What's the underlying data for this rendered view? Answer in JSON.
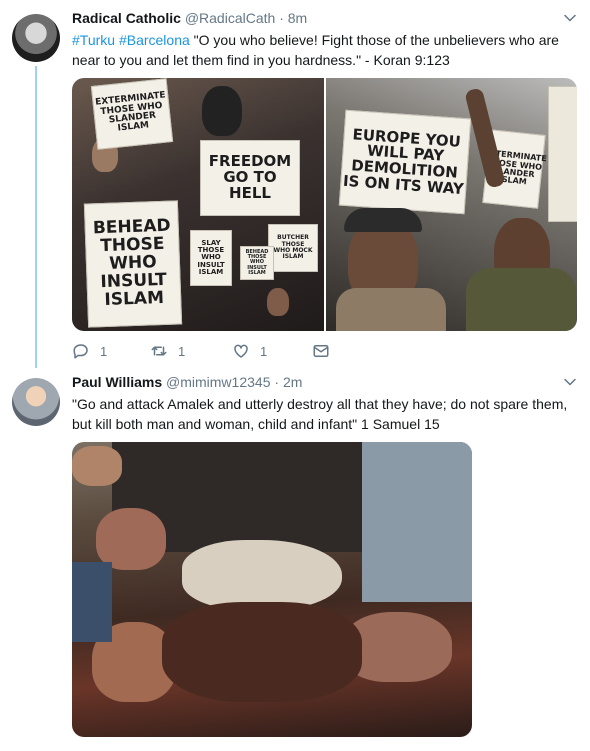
{
  "tweets": [
    {
      "author_name": "Radical Catholic",
      "handle": "@RadicalCath",
      "separator": "·",
      "time": "8m",
      "hashtags": [
        "#Turku",
        "#Barcelona"
      ],
      "text": "\"O you who believe! Fight those of the unbelievers who are near to you and let them find in you hardness.\" - Koran 9:123",
      "media": {
        "left_photo_signs": [
          {
            "lines": [
              "EXTERMINATE",
              "THOSE WHO",
              "SLANDER",
              "ISLAM"
            ]
          },
          {
            "lines": [
              "FREEDOM",
              "GO TO",
              "HELL"
            ]
          },
          {
            "lines": [
              "BEHEAD",
              "THOSE",
              "WHO",
              "INSULT",
              "ISLAM"
            ]
          },
          {
            "lines": [
              "SLAY",
              "THOSE",
              "WHO",
              "INSULT",
              "ISLAM"
            ]
          },
          {
            "lines": [
              "BUTCHER",
              "THOSE",
              "WHO MOCK",
              "ISLAM"
            ]
          },
          {
            "lines": [
              "BEHEAD THOSE",
              "WHO INSULT",
              "ISLAM"
            ]
          }
        ],
        "right_photo_signs": [
          {
            "lines": [
              "EUROPE YOU",
              "WILL PAY",
              "DEMOLITION",
              "IS ON ITS WAY"
            ]
          },
          {
            "lines": [
              "EXTERMINATE",
              "THOSE WHO",
              "SLANDER",
              "ISLAM"
            ]
          }
        ]
      },
      "actions": {
        "reply_count": "1",
        "retweet_count": "1",
        "like_count": "1",
        "icons": [
          "reply-icon",
          "retweet-icon",
          "like-icon",
          "message-icon"
        ]
      }
    },
    {
      "author_name": "Paul Williams",
      "handle": "@mimimw12345",
      "separator": "·",
      "time": "2m",
      "text": "\"Go and attack Amalek and utterly destroy all that they have; do not spare them, but kill both man and woman, child and infant\" 1 Samuel 15"
    }
  ],
  "colors": {
    "link": "#1b95e0",
    "secondary_text": "#657786",
    "thread_line": "#9fd0f5",
    "primary_text": "#14171a"
  }
}
